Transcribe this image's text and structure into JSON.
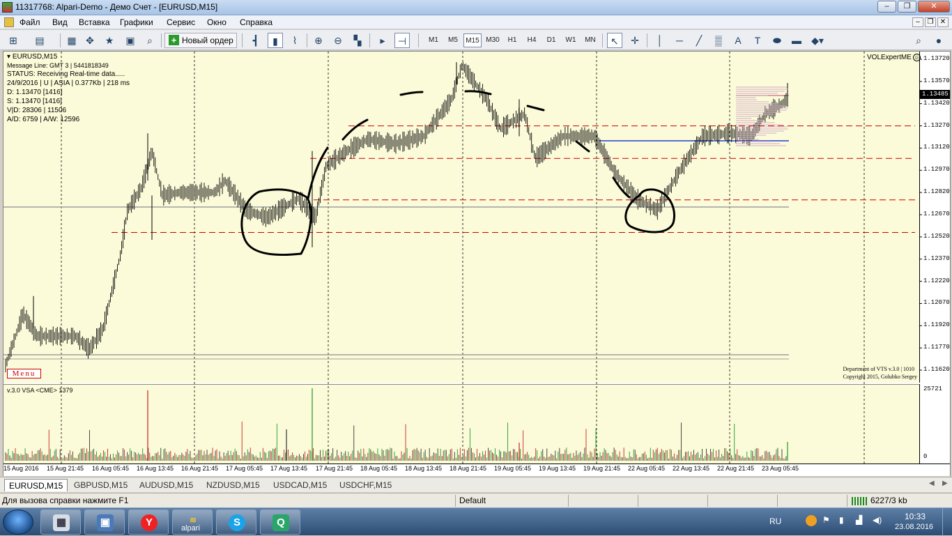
{
  "window": {
    "title": "11317768: Alpari-Demo - Демо Счет - [EURUSD,M15]",
    "buttons": {
      "minimize": "‒",
      "maximize": "❐",
      "close": "✕"
    }
  },
  "menu": {
    "items": [
      "Файл",
      "Вид",
      "Вставка",
      "Графики",
      "Сервис",
      "Окно",
      "Справка"
    ],
    "mdi_buttons": {
      "minimize": "‒",
      "restore": "❐",
      "close": "✕"
    }
  },
  "toolbar": {
    "new_order_label": "Новый ордер",
    "timeframes": [
      "M1",
      "M5",
      "M15",
      "M30",
      "H1",
      "H4",
      "D1",
      "W1",
      "MN"
    ],
    "active_timeframe": "M15",
    "text_tool_label": "A",
    "label_tool_label": "T"
  },
  "chart": {
    "symbol_header": "EURUSD,M15",
    "info_lines": [
      "Message Line: GMT 3 | 5441818349",
      "STATUS:  Receiving Real-time data.....",
      "24/9/2016 | U | ASIA | 0.377Kb | 218 ms",
      "D: 1.13470  [1416]",
      "S: 1.13470  [1416]",
      "V|D: 28306 | 11506",
      "A/D: 6759 | A/W: 12596"
    ],
    "expert_label": "VOLExpertME",
    "menu_button": "Menu",
    "credit_line1": "Department of VTS  v.3.0 | 1010",
    "credit_line2": "Copyright 2015, Golubko Sergey",
    "current_price": "1.13485",
    "price_ticks": [
      "1.13720",
      "1.13570",
      "1.13420",
      "1.13270",
      "1.13120",
      "1.12970",
      "1.12820",
      "1.12670",
      "1.12520",
      "1.12370",
      "1.12220",
      "1.12070",
      "1.11920",
      "1.11770",
      "1.11620"
    ],
    "time_ticks": [
      "15 Aug 2016",
      "15 Aug 21:45",
      "16 Aug 05:45",
      "16 Aug 13:45",
      "16 Aug 21:45",
      "17 Aug 05:45",
      "17 Aug 13:45",
      "17 Aug 21:45",
      "18 Aug 05:45",
      "18 Aug 13:45",
      "18 Aug 21:45",
      "19 Aug 05:45",
      "19 Aug 13:45",
      "19 Aug 21:45",
      "22 Aug 05:45",
      "22 Aug 13:45",
      "22 Aug 21:45",
      "23 Aug 05:45"
    ],
    "volume_indicator_label": "v.3.0 VSA <CME> 1379",
    "volume_max": "25721",
    "volume_min": "0",
    "colors": {
      "background": "#fbfbd9",
      "bars": "#000000",
      "support": "#cc0000",
      "level_blue": "#1f3fd0",
      "level_gray": "#a0a0a0"
    }
  },
  "chart_tabs": [
    "EURUSD,M15",
    "GBPUSD,M15",
    "AUDUSD,M15",
    "NZDUSD,M15",
    "USDCAD,M15",
    "USDCHF,M15"
  ],
  "active_chart_tab": "EURUSD,M15",
  "statusbar": {
    "help": "Для вызова справки нажмите F1",
    "profile": "Default",
    "traffic": "6227/3 kb"
  },
  "taskbar": {
    "apps": [
      {
        "name": "calculator",
        "icon": "calculator-icon"
      },
      {
        "name": "explorer",
        "icon": "computer-icon"
      },
      {
        "name": "yandex",
        "icon": "yandex-icon",
        "glyph": "Y"
      },
      {
        "name": "alpari",
        "icon": "alpari-icon",
        "label": "alpari"
      },
      {
        "name": "skype",
        "icon": "skype-icon",
        "glyph": "S"
      },
      {
        "name": "qip",
        "icon": "qip-icon",
        "glyph": "Q"
      }
    ],
    "language": "RU",
    "time": "10:33",
    "date": "23.08.2016"
  }
}
